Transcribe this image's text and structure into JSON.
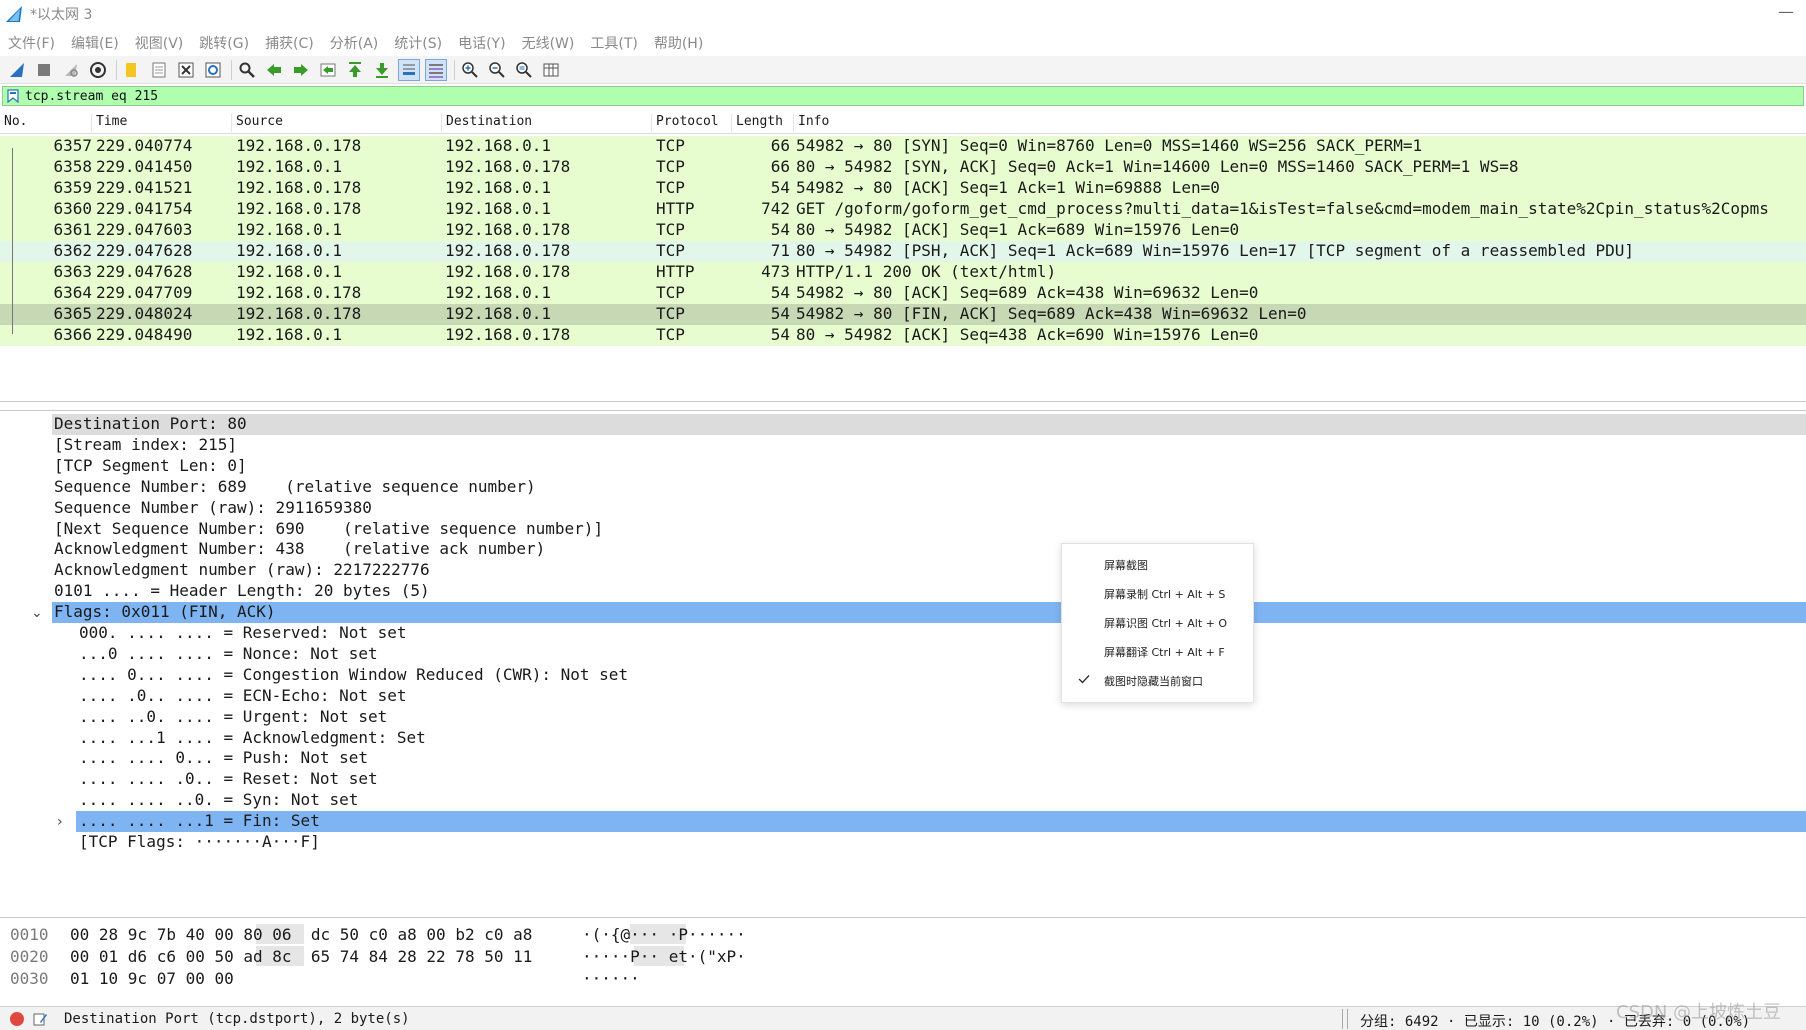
{
  "window": {
    "title": "*以太网 3",
    "minimize": "—"
  },
  "menu": [
    "文件(F)",
    "编辑(E)",
    "视图(V)",
    "跳转(G)",
    "捕获(C)",
    "分析(A)",
    "统计(S)",
    "电话(Y)",
    "无线(W)",
    "工具(T)",
    "帮助(H)"
  ],
  "filter": {
    "value": "tcp.stream eq 215"
  },
  "packet_list": {
    "columns": [
      "No.",
      "Time",
      "Source",
      "Destination",
      "Protocol",
      "Length",
      "Info"
    ],
    "rows": [
      {
        "no": "6357",
        "time": "229.040774",
        "src": "192.168.0.178",
        "dst": "192.168.0.1",
        "proto": "TCP",
        "len": "66",
        "info": "54982 → 80 [SYN] Seq=0 Win=8760 Len=0 MSS=1460 WS=256 SACK_PERM=1"
      },
      {
        "no": "6358",
        "time": "229.041450",
        "src": "192.168.0.1",
        "dst": "192.168.0.178",
        "proto": "TCP",
        "len": "66",
        "info": "80 → 54982 [SYN, ACK] Seq=0 Ack=1 Win=14600 Len=0 MSS=1460 SACK_PERM=1 WS=8"
      },
      {
        "no": "6359",
        "time": "229.041521",
        "src": "192.168.0.178",
        "dst": "192.168.0.1",
        "proto": "TCP",
        "len": "54",
        "info": "54982 → 80 [ACK] Seq=1 Ack=1 Win=69888 Len=0"
      },
      {
        "no": "6360",
        "time": "229.041754",
        "src": "192.168.0.178",
        "dst": "192.168.0.1",
        "proto": "HTTP",
        "len": "742",
        "info": "GET /goform/goform_get_cmd_process?multi_data=1&isTest=false&cmd=modem_main_state%2Cpin_status%2Copms"
      },
      {
        "no": "6361",
        "time": "229.047603",
        "src": "192.168.0.1",
        "dst": "192.168.0.178",
        "proto": "TCP",
        "len": "54",
        "info": "80 → 54982 [ACK] Seq=1 Ack=689 Win=15976 Len=0"
      },
      {
        "no": "6362",
        "time": "229.047628",
        "src": "192.168.0.1",
        "dst": "192.168.0.178",
        "proto": "TCP",
        "len": "71",
        "info": "80 → 54982 [PSH, ACK] Seq=1 Ack=689 Win=15976 Len=17 [TCP segment of a reassembled PDU]"
      },
      {
        "no": "6363",
        "time": "229.047628",
        "src": "192.168.0.1",
        "dst": "192.168.0.178",
        "proto": "HTTP",
        "len": "473",
        "info": "HTTP/1.1 200 OK  (text/html)"
      },
      {
        "no": "6364",
        "time": "229.047709",
        "src": "192.168.0.178",
        "dst": "192.168.0.1",
        "proto": "TCP",
        "len": "54",
        "info": "54982 → 80 [ACK] Seq=689 Ack=438 Win=69632 Len=0"
      },
      {
        "no": "6365",
        "time": "229.048024",
        "src": "192.168.0.178",
        "dst": "192.168.0.1",
        "proto": "TCP",
        "len": "54",
        "info": "54982 → 80 [FIN, ACK] Seq=689 Ack=438 Win=69632 Len=0"
      },
      {
        "no": "6366",
        "time": "229.048490",
        "src": "192.168.0.1",
        "dst": "192.168.0.178",
        "proto": "TCP",
        "len": "54",
        "info": "80 → 54982 [ACK] Seq=438 Ack=690 Win=15976 Len=0"
      }
    ]
  },
  "details": {
    "lines": [
      "Destination Port: 80",
      "[Stream index: 215]",
      "[TCP Segment Len: 0]",
      "Sequence Number: 689    (relative sequence number)",
      "Sequence Number (raw): 2911659380",
      "[Next Sequence Number: 690    (relative sequence number)]",
      "Acknowledgment Number: 438    (relative ack number)",
      "Acknowledgment number (raw): 2217222776",
      "0101 .... = Header Length: 20 bytes (5)",
      "Flags: 0x011 (FIN, ACK)",
      "000. .... .... = Reserved: Not set",
      "...0 .... .... = Nonce: Not set",
      ".... 0... .... = Congestion Window Reduced (CWR): Not set",
      ".... .0.. .... = ECN-Echo: Not set",
      ".... ..0. .... = Urgent: Not set",
      ".... ...1 .... = Acknowledgment: Set",
      ".... .... 0... = Push: Not set",
      ".... .... .0.. = Reset: Not set",
      ".... .... ..0. = Syn: Not set",
      ".... .... ...1 = Fin: Set",
      "[TCP Flags: ·······A···F]"
    ]
  },
  "context_menu": {
    "items": [
      "屏幕截图",
      "屏幕录制 Ctrl + Alt + S",
      "屏幕识图 Ctrl + Alt + O",
      "屏幕翻译 Ctrl + Alt + F",
      "截图时隐藏当前窗口"
    ]
  },
  "hex": {
    "rows": [
      {
        "offset": "0010",
        "bytes": "00 28 9c 7b 40 00 80 06  dc 50 c0 a8 00 b2 c0 a8",
        "ascii": "·(·{@··· ·P······"
      },
      {
        "offset": "0020",
        "bytes": "00 01 d6 c6 00 50 ad 8c  65 74 84 28 22 78 50 11",
        "ascii": "·····P·· et·(\"xP·"
      },
      {
        "offset": "0030",
        "bytes": "01 10 9c 07 00 00",
        "ascii": "······"
      }
    ]
  },
  "status": {
    "field_desc": "Destination Port (tcp.dstport), 2 byte(s)",
    "stats": "分组: 6492 · 已显示: 10 (0.2%) · 已丢弃: 0 (0.0%)"
  },
  "watermark": "CSDN @上坡炼土豆",
  "colors": {
    "tcp_row": "#e7fdd0",
    "selected_row": "#e3f6ea",
    "marked_row": "#c7d8b4",
    "filter_bg": "#afffaf",
    "highlight_blue": "#7fb4f3"
  }
}
